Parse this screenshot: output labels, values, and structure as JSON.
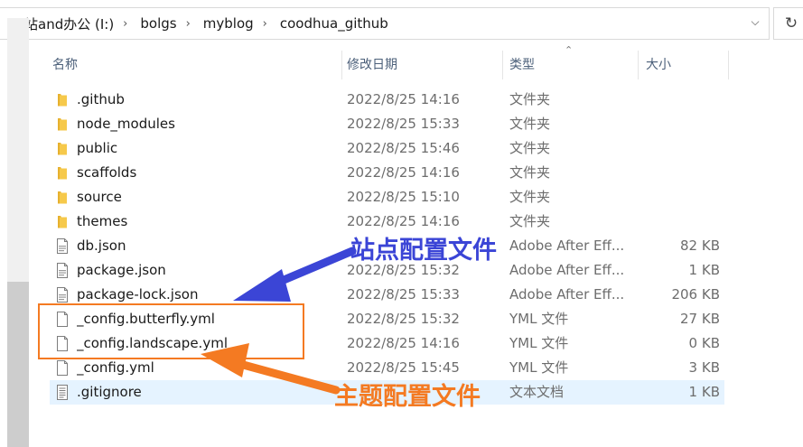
{
  "breadcrumb": [
    {
      "label": "网站and办公 (I:)"
    },
    {
      "label": "bolgs"
    },
    {
      "label": "myblog"
    },
    {
      "label": "coodhua_github"
    }
  ],
  "columns": {
    "name": "名称",
    "date": "修改日期",
    "type": "类型",
    "size": "大小"
  },
  "files": [
    {
      "name": ".github",
      "date": "2022/8/25 14:16",
      "type": "文件夹",
      "size": "",
      "icon": "folder-icon"
    },
    {
      "name": "node_modules",
      "date": "2022/8/25 15:33",
      "type": "文件夹",
      "size": "",
      "icon": "folder-icon"
    },
    {
      "name": "public",
      "date": "2022/8/25 15:46",
      "type": "文件夹",
      "size": "",
      "icon": "folder-icon"
    },
    {
      "name": "scaffolds",
      "date": "2022/8/25 14:16",
      "type": "文件夹",
      "size": "",
      "icon": "folder-icon"
    },
    {
      "name": "source",
      "date": "2022/8/25 15:10",
      "type": "文件夹",
      "size": "",
      "icon": "folder-icon"
    },
    {
      "name": "themes",
      "date": "2022/8/25 14:16",
      "type": "文件夹",
      "size": "",
      "icon": "folder-icon"
    },
    {
      "name": "db.json",
      "date": "",
      "type": "Adobe After Eff...",
      "size": "82 KB",
      "icon": "json-file-icon"
    },
    {
      "name": "package.json",
      "date": "2022/8/25 15:32",
      "type": "Adobe After Eff...",
      "size": "1 KB",
      "icon": "json-file-icon"
    },
    {
      "name": "package-lock.json",
      "date": "2022/8/25 15:33",
      "type": "Adobe After Eff...",
      "size": "206 KB",
      "icon": "json-file-icon"
    },
    {
      "name": "_config.butterfly.yml",
      "date": "2022/8/25 15:32",
      "type": "YML 文件",
      "size": "27 KB",
      "icon": "blank-file-icon"
    },
    {
      "name": "_config.landscape.yml",
      "date": "2022/8/25 14:16",
      "type": "YML 文件",
      "size": "0 KB",
      "icon": "blank-file-icon"
    },
    {
      "name": "_config.yml",
      "date": "2022/8/25 15:45",
      "type": "YML 文件",
      "size": "3 KB",
      "icon": "blank-file-icon"
    },
    {
      "name": ".gitignore",
      "date": "",
      "type": "文本文档",
      "size": "1 KB",
      "icon": "text-file-icon"
    }
  ],
  "selected_index": 12,
  "annotations": {
    "site_config": "站点配置文件",
    "theme_config": "主题配置文件"
  },
  "colors": {
    "accent_blue": "#3b45d6",
    "accent_orange": "#f47a22",
    "selection": "#e5f3ff"
  }
}
